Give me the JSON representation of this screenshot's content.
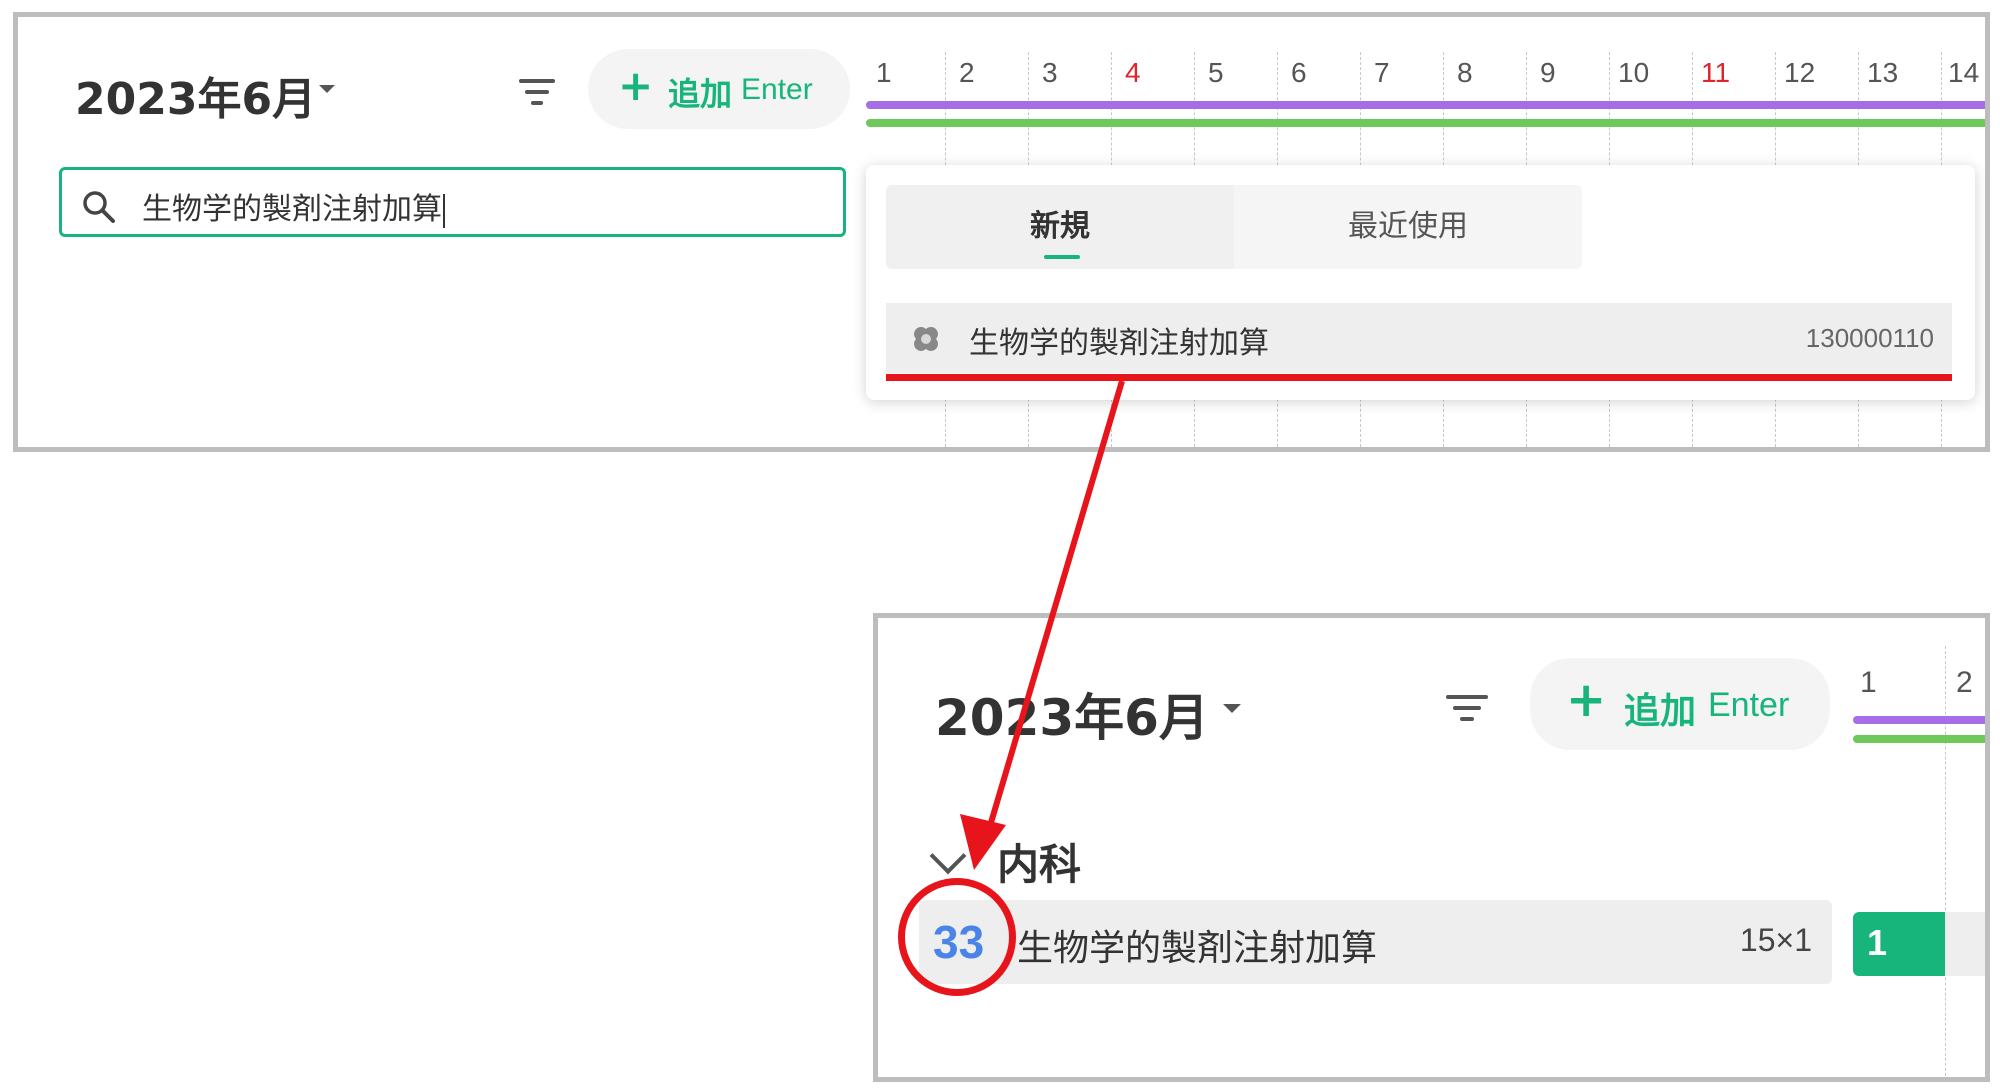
{
  "before": {
    "header": {
      "month": "2023年6月",
      "add_button": {
        "label": "追加",
        "shortcut": "Enter"
      }
    },
    "calendar": {
      "days": [
        "1",
        "2",
        "3",
        "4",
        "5",
        "6",
        "7",
        "8",
        "9",
        "10",
        "11",
        "12",
        "13",
        "14"
      ],
      "holidays": [
        "4",
        "11"
      ],
      "bar_colors": [
        "#a66ee6",
        "#6cc95a"
      ]
    },
    "search": {
      "value": "生物学的製剤注射加算"
    },
    "dropdown": {
      "tabs": [
        "新規",
        "最近使用"
      ],
      "active_tab": "新規",
      "result": {
        "name": "生物学的製剤注射加算",
        "code": "130000110",
        "icon": "bandage-icon"
      }
    }
  },
  "after": {
    "header": {
      "month": "2023年6月",
      "add_button": {
        "label": "追加",
        "shortcut": "Enter"
      }
    },
    "calendar": {
      "days": [
        "1",
        "2"
      ]
    },
    "group": {
      "label": "内科"
    },
    "item": {
      "number": "33",
      "name": "生物学的製剤注射加算",
      "quantity": "15×1",
      "day1_count": "1"
    }
  },
  "annotation": {
    "color": "#e8141b"
  }
}
